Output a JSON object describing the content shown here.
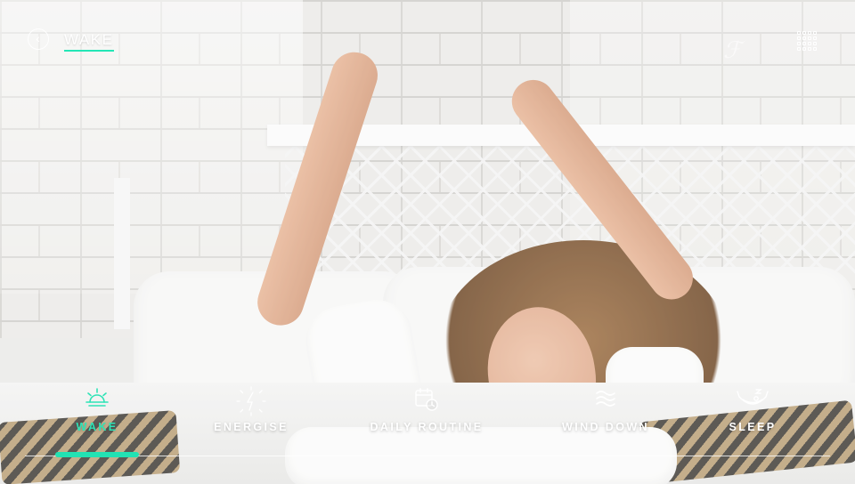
{
  "header": {
    "title": "WAKE",
    "back_icon": "chevron-left-icon",
    "menu_icon": "grid-icon",
    "accent_color": "#22e2b3"
  },
  "nav": {
    "items": [
      {
        "label": "WAKE",
        "icon": "sunrise-icon",
        "active": true
      },
      {
        "label": "ENERGISE",
        "icon": "lightning-burst-icon",
        "active": false
      },
      {
        "label": "DAILY ROUTINE",
        "icon": "calendar-clock-icon",
        "active": false
      },
      {
        "label": "WIND DOWN",
        "icon": "waves-icon",
        "active": false
      },
      {
        "label": "SLEEP",
        "icon": "hammock-icon",
        "active": false
      }
    ]
  }
}
